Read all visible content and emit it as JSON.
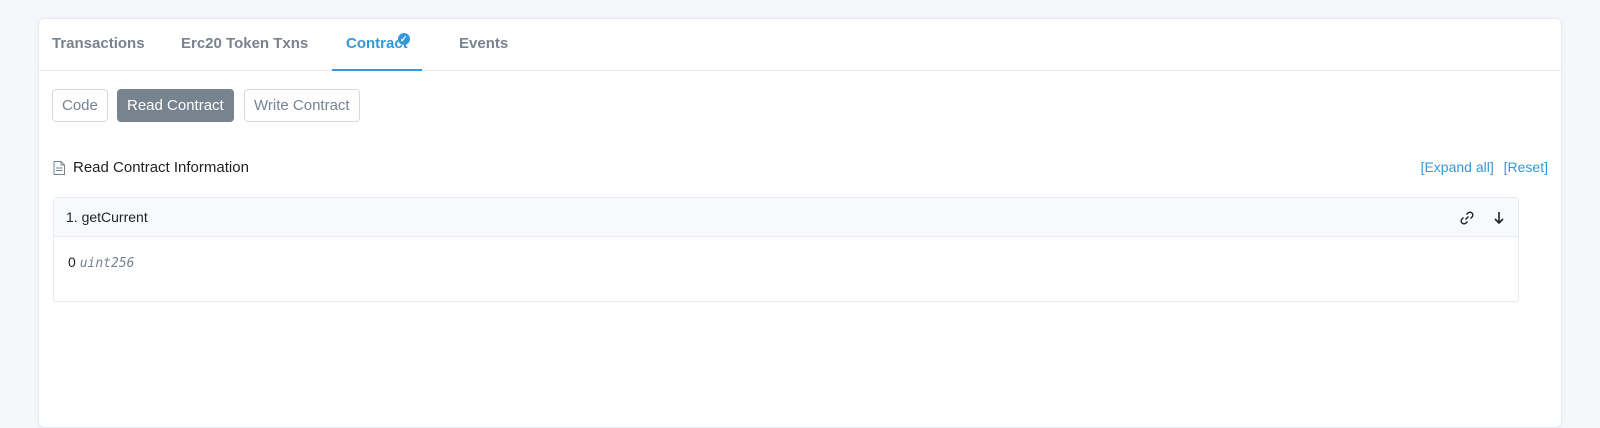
{
  "tabs": [
    {
      "label": "Transactions"
    },
    {
      "label": "Erc20 Token Txns"
    },
    {
      "label": "Contract"
    },
    {
      "label": "Events"
    }
  ],
  "contract_buttons": {
    "code": "Code",
    "read": "Read Contract",
    "write": "Write Contract"
  },
  "section": {
    "title": "Read Contract Information",
    "expand_all": "[Expand all]",
    "reset": "[Reset]"
  },
  "functions": [
    {
      "title": "1. getCurrent",
      "value": "0",
      "type": "uint256"
    }
  ],
  "icons": {
    "verified": "check-circle-icon",
    "section": "document-icon",
    "link": "link-icon",
    "collapse": "arrow-down-icon"
  },
  "colors": {
    "accent": "#3498db",
    "muted": "#77838f",
    "active_button": "#77838f"
  }
}
